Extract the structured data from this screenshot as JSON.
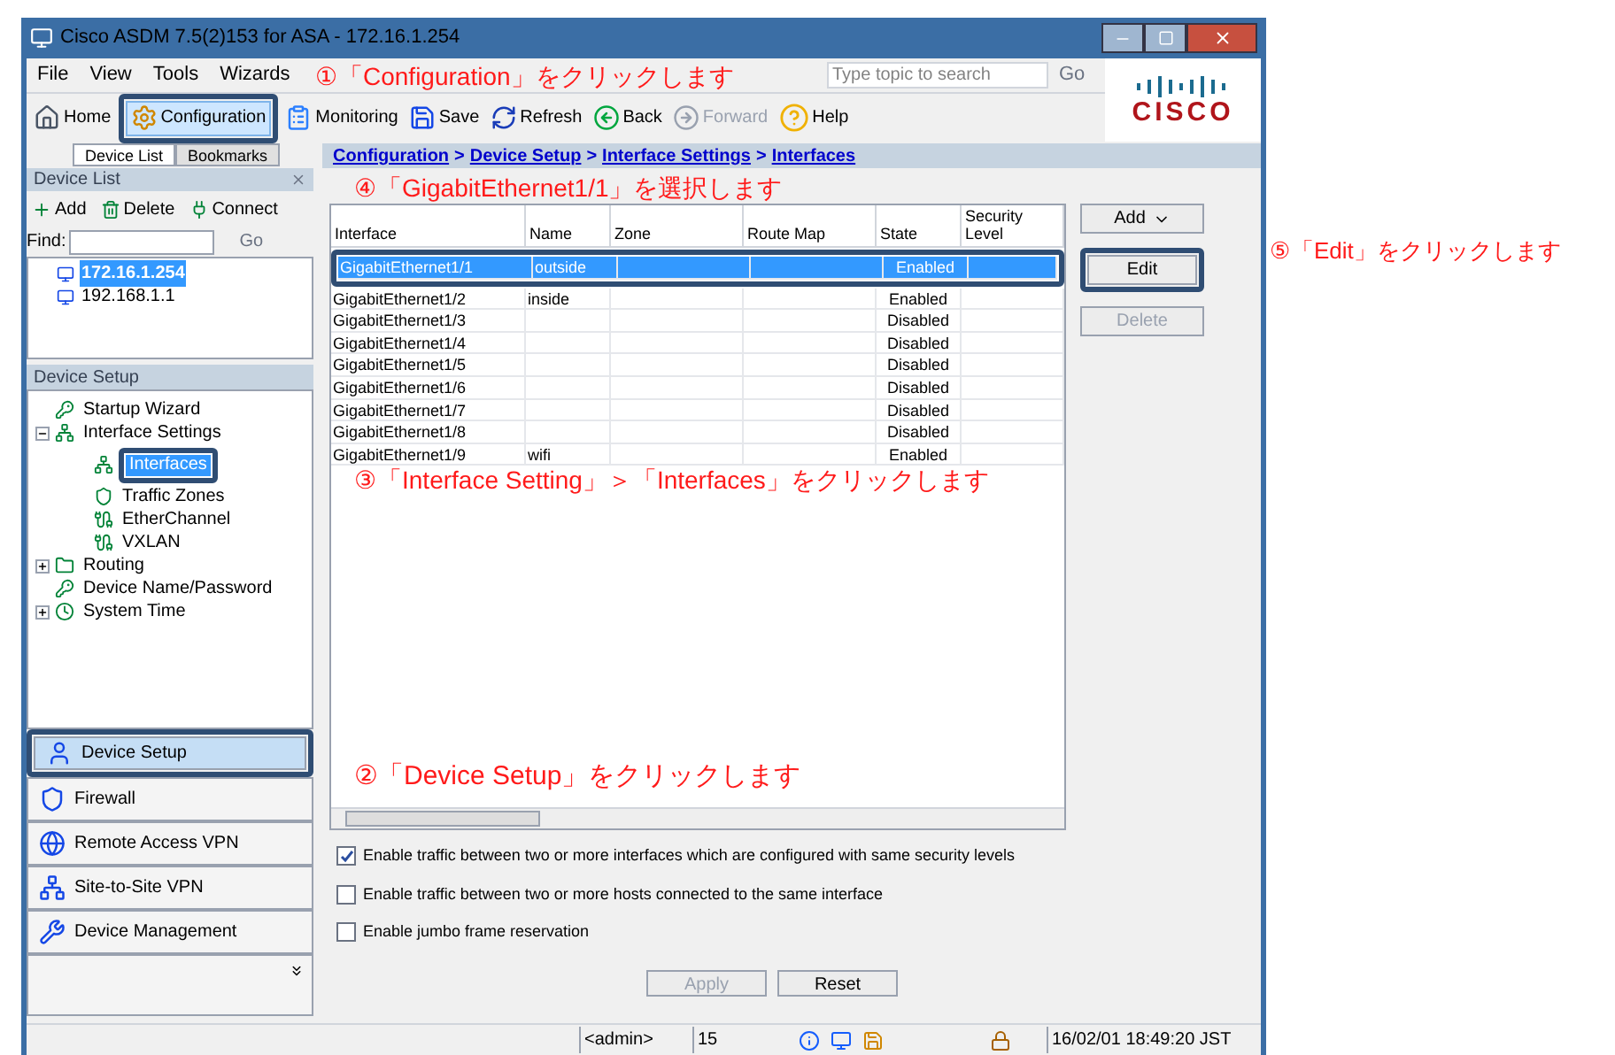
{
  "window": {
    "title": "Cisco ASDM 7.5(2)153 for ASA - 172.16.1.254"
  },
  "menu": [
    "File",
    "View",
    "Tools",
    "Wizards"
  ],
  "search": {
    "placeholder": "Type topic to search",
    "button": "Go"
  },
  "logo_text": "CISCO",
  "toolbar": [
    {
      "label": "Home",
      "kind": "home",
      "disabled": false,
      "highlighted": false
    },
    {
      "label": "Configuration",
      "kind": "config",
      "disabled": false,
      "highlighted": true
    },
    {
      "label": "Monitoring",
      "kind": "monitor",
      "disabled": false,
      "highlighted": false
    },
    {
      "label": "Save",
      "kind": "save",
      "disabled": false,
      "highlighted": false
    },
    {
      "label": "Refresh",
      "kind": "refresh",
      "disabled": false,
      "highlighted": false
    },
    {
      "label": "Back",
      "kind": "back",
      "disabled": false,
      "highlighted": false
    },
    {
      "label": "Forward",
      "kind": "forward",
      "disabled": true,
      "highlighted": false
    },
    {
      "label": "Help",
      "kind": "help",
      "disabled": false,
      "highlighted": false
    }
  ],
  "left_tabs": [
    {
      "label": "Device List",
      "selected": true
    },
    {
      "label": "Bookmarks",
      "selected": false
    }
  ],
  "breadcrumb": {
    "items": [
      "Configuration",
      "Device Setup",
      "Interface Settings",
      "Interfaces"
    ],
    "separator": ">"
  },
  "device_list": {
    "title": "Device List",
    "actions": [
      {
        "label": "Add",
        "kind": "add"
      },
      {
        "label": "Delete",
        "kind": "delete"
      },
      {
        "label": "Connect",
        "kind": "connect"
      }
    ],
    "find_label": "Find:",
    "go": "Go",
    "devices": [
      {
        "label": "172.16.1.254",
        "selected": true
      },
      {
        "label": "192.168.1.1",
        "selected": false
      }
    ]
  },
  "device_setup": {
    "title": "Device Setup",
    "tree": [
      {
        "label": "Startup Wizard",
        "selected": false,
        "highlighted": false
      },
      {
        "label": "Interface Settings",
        "selected": false,
        "highlighted": false,
        "expanded": true,
        "children": [
          {
            "label": "Interfaces",
            "selected": true,
            "highlighted": true
          },
          {
            "label": "Traffic Zones",
            "selected": false,
            "highlighted": false
          },
          {
            "label": "EtherChannel",
            "selected": false,
            "highlighted": false
          },
          {
            "label": "VXLAN",
            "selected": false,
            "highlighted": false
          }
        ]
      },
      {
        "label": "Routing",
        "selected": false,
        "highlighted": false,
        "expanded": false
      },
      {
        "label": "Device Name/Password",
        "selected": false,
        "highlighted": false
      },
      {
        "label": "System Time",
        "selected": false,
        "highlighted": false,
        "expanded": false
      }
    ]
  },
  "nav_buttons": [
    {
      "label": "Device Setup",
      "selected": true,
      "highlighted": true
    },
    {
      "label": "Firewall",
      "selected": false,
      "highlighted": false
    },
    {
      "label": "Remote Access VPN",
      "selected": false,
      "highlighted": false
    },
    {
      "label": "Site-to-Site VPN",
      "selected": false,
      "highlighted": false
    },
    {
      "label": "Device Management",
      "selected": false,
      "highlighted": false
    }
  ],
  "table": {
    "columns": [
      "Interface",
      "Name",
      "Zone",
      "Route Map",
      "State",
      "Security Level"
    ],
    "rows": [
      {
        "cells": [
          "GigabitEthernet1/1",
          "outside",
          "",
          "",
          "Enabled",
          ""
        ],
        "selected": true,
        "highlighted": true
      },
      {
        "cells": [
          "GigabitEthernet1/2",
          "inside",
          "",
          "",
          "Enabled",
          ""
        ],
        "selected": false,
        "highlighted": false
      },
      {
        "cells": [
          "GigabitEthernet1/3",
          "",
          "",
          "",
          "Disabled",
          ""
        ],
        "selected": false,
        "highlighted": false
      },
      {
        "cells": [
          "GigabitEthernet1/4",
          "",
          "",
          "",
          "Disabled",
          ""
        ],
        "selected": false,
        "highlighted": false
      },
      {
        "cells": [
          "GigabitEthernet1/5",
          "",
          "",
          "",
          "Disabled",
          ""
        ],
        "selected": false,
        "highlighted": false
      },
      {
        "cells": [
          "GigabitEthernet1/6",
          "",
          "",
          "",
          "Disabled",
          ""
        ],
        "selected": false,
        "highlighted": false
      },
      {
        "cells": [
          "GigabitEthernet1/7",
          "",
          "",
          "",
          "Disabled",
          ""
        ],
        "selected": false,
        "highlighted": false
      },
      {
        "cells": [
          "GigabitEthernet1/8",
          "",
          "",
          "",
          "Disabled",
          ""
        ],
        "selected": false,
        "highlighted": false
      },
      {
        "cells": [
          "GigabitEthernet1/9",
          "wifi",
          "",
          "",
          "Enabled",
          ""
        ],
        "selected": false,
        "highlighted": false
      }
    ]
  },
  "side_buttons": [
    {
      "label": "Add",
      "disabled": false,
      "dropdown": true,
      "highlighted": false
    },
    {
      "label": "Edit",
      "disabled": false,
      "dropdown": false,
      "highlighted": true
    },
    {
      "label": "Delete",
      "disabled": true,
      "dropdown": false,
      "highlighted": false
    }
  ],
  "options": [
    {
      "label": "Enable traffic between two or more interfaces which are configured with same security levels",
      "checked": true
    },
    {
      "label": "Enable traffic between two or more hosts connected to the same interface",
      "checked": false
    },
    {
      "label": "Enable jumbo frame reservation",
      "checked": false
    }
  ],
  "footer_buttons": [
    {
      "label": "Apply",
      "disabled": true
    },
    {
      "label": "Reset",
      "disabled": false
    }
  ],
  "status_bar": {
    "user": "<admin>",
    "level": "15",
    "time": "16/02/01 18:49:20 JST"
  },
  "annotations": [
    "①「Configuration」をクリックします",
    "④「GigabitEthernet1/1」を選択します",
    "⑤「Edit」をクリックします",
    "③「Interface Setting」＞「Interfaces」をクリックします",
    "②「Device Setup」をクリックします"
  ]
}
